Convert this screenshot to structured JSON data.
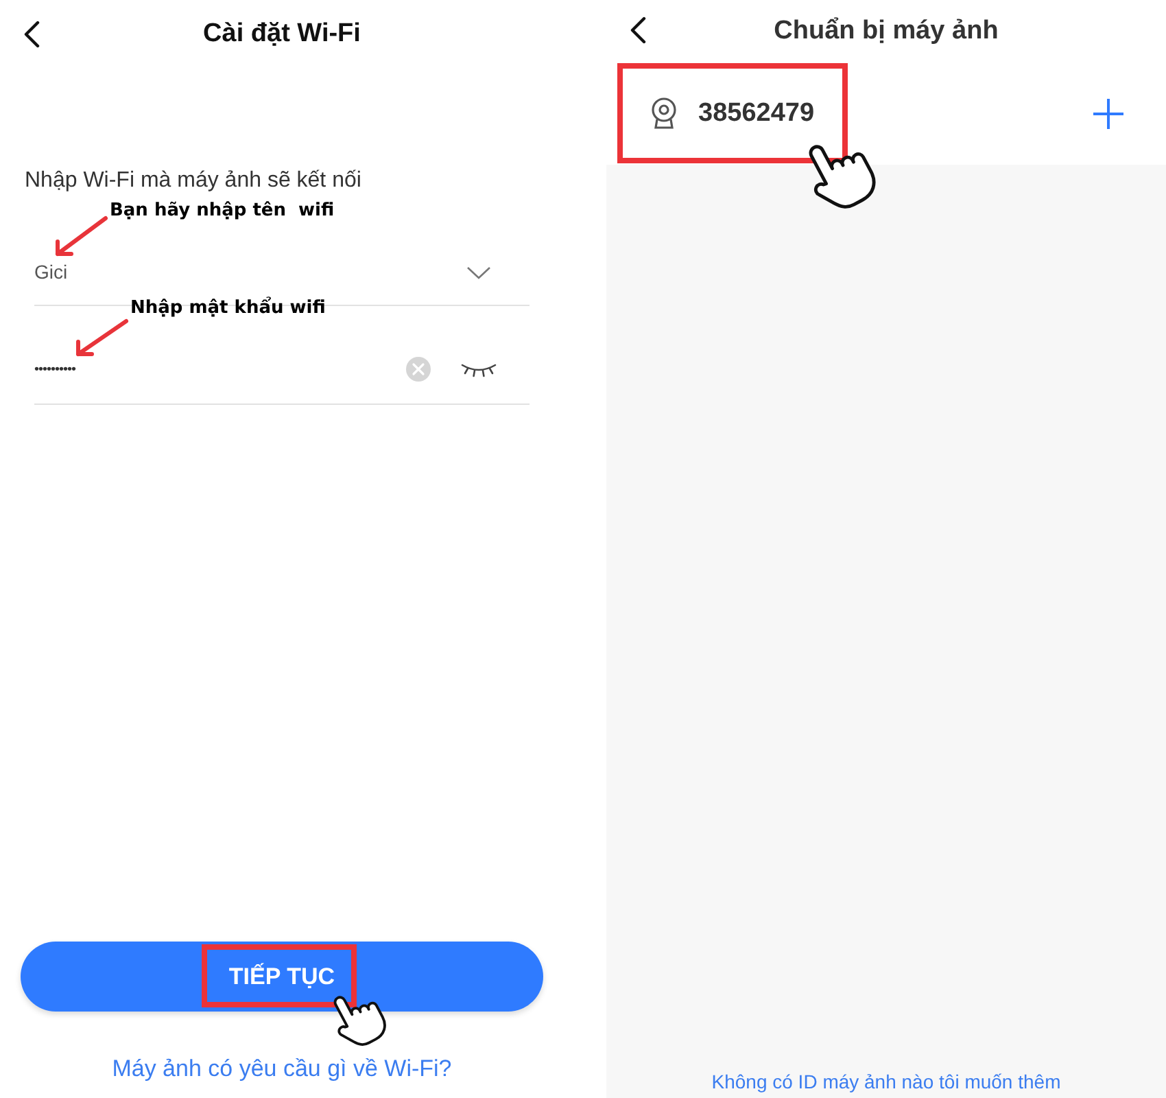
{
  "wifi_setup": {
    "title": "Cài đặt Wi-Fi",
    "prompt": "Nhập Wi-Fi mà máy ảnh sẽ kết nối",
    "ssid": {
      "value": "Gici",
      "annotation": "Bạn hãy nhập tên  wifi"
    },
    "password": {
      "value": "••••••••••",
      "annotation": "Nhập mật khẩu wifi"
    },
    "continue_button": {
      "label": "TIẾP TỤC",
      "highlighted": true
    },
    "help_link": "Máy ảnh có yêu cầu gì về Wi-Fi?"
  },
  "camera_setup": {
    "title": "Chuẩn bị máy ảnh",
    "cameras": [
      {
        "id": "38562479",
        "highlighted": true
      }
    ],
    "footer_link": "Không có ID máy ảnh nào tôi muốn thêm"
  }
}
